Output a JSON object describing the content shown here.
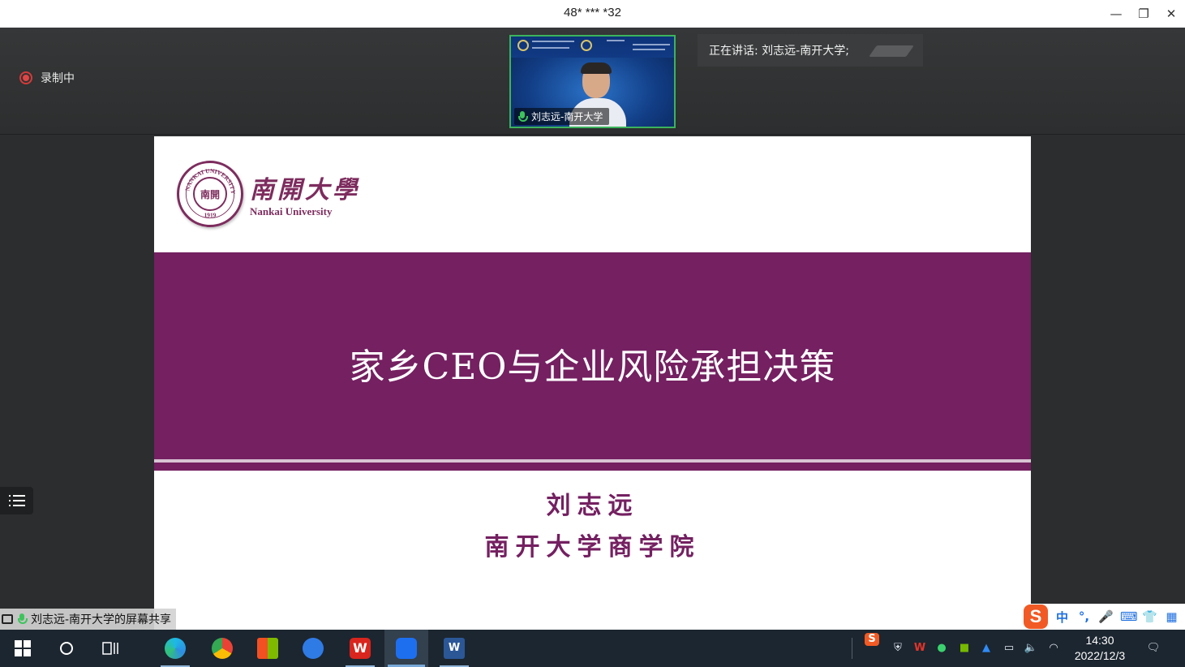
{
  "window": {
    "title": "48* *** *32"
  },
  "header": {
    "recording_label": "录制中",
    "active_video_name": "刘志远-南开大学",
    "speaking_label": "正在讲话: 刘志远-南开大学;"
  },
  "slide": {
    "logo_cn": "南開大學",
    "logo_en": "Nankai University",
    "seal_center": "南開",
    "seal_ring": "NANKAI UNIVERSITY 1919",
    "title": "家乡CEO与企业风险承担决策",
    "author": "刘志远",
    "affiliation": "南开大学商学院"
  },
  "share_label": "刘志远-南开大学的屏幕共享",
  "ime": {
    "items": [
      "中",
      "°,",
      "🎤",
      "⌨",
      "👕",
      "▦"
    ]
  },
  "taskbar": {
    "clock_time": "14:30",
    "clock_date": "2022/12/3",
    "apps": [
      "start",
      "search",
      "task-view",
      "edge",
      "chrome",
      "store",
      "feishu",
      "wps",
      "tencent-meeting",
      "word"
    ]
  },
  "colors": {
    "slide_band": "#742061",
    "accent_green": "#3cb35c",
    "rec_red": "#e04545"
  }
}
